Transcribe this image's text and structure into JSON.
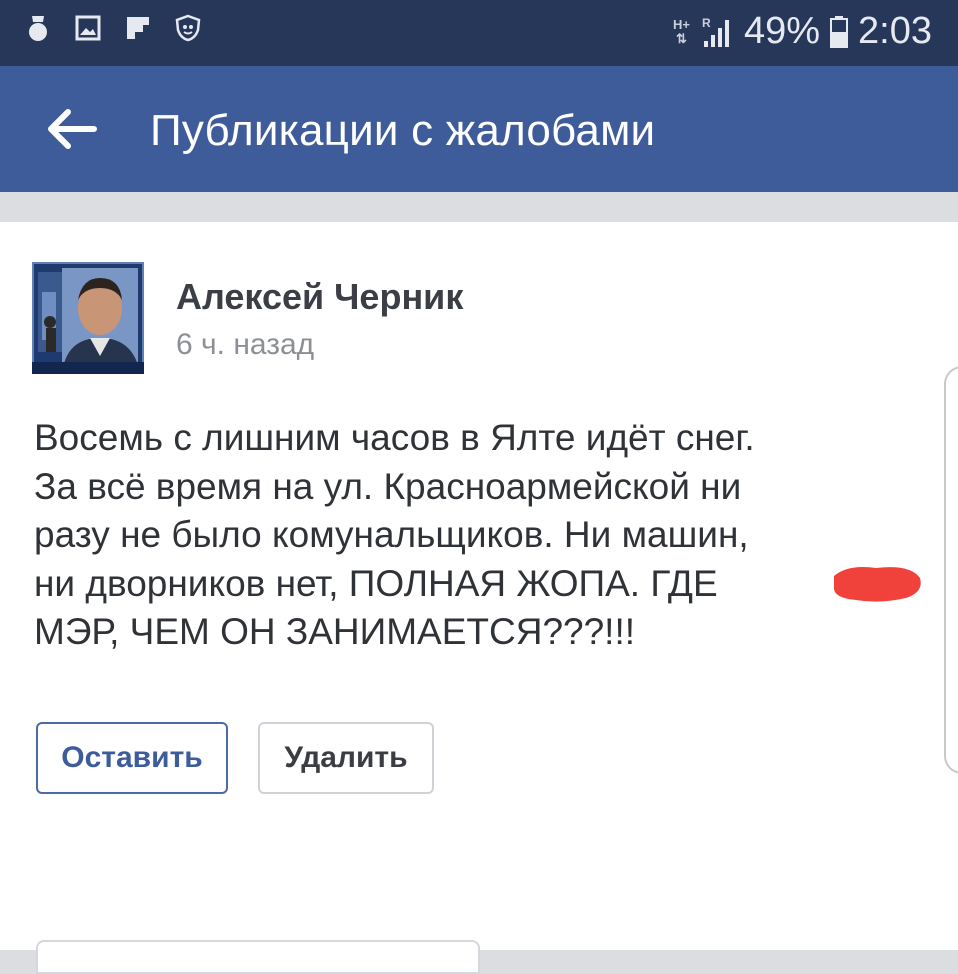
{
  "status_bar": {
    "left_icons": [
      "bomb-notification-icon",
      "gallery-notification-icon",
      "flipboard-icon",
      "antivirus-shield-icon"
    ],
    "network_type": "H+",
    "roaming": "R",
    "battery_percent": "49%",
    "time": "2:03"
  },
  "app_bar": {
    "back_icon": "arrow-left-icon",
    "title": "Публикации с жалобами"
  },
  "post": {
    "author": "Алексей Черник",
    "time": "6 ч. назад",
    "body_lines": [
      "Восемь с лишним часов в Ялте идёт снег.",
      "За всё время на ул. Красноармейской ни",
      "разу не было комунальщиков. Ни машин,",
      "ни дворников нет, ПОЛНАЯ ЖОПА. ГДЕ",
      "МЭР, ЧЕМ ОН ЗАНИМАЕТСЯ???!!!"
    ],
    "redaction_color": "#f0413a"
  },
  "actions": {
    "keep_label": "Оставить",
    "delete_label": "Удалить"
  },
  "colors": {
    "status_bar": "#27375a",
    "app_bar": "#3e5b9a",
    "accent": "#3d5c9c",
    "background": "#dcdde1"
  }
}
